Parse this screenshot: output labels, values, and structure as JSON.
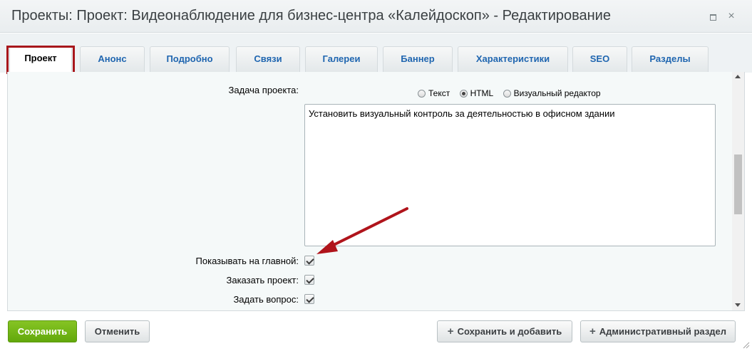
{
  "window": {
    "title": "Проекты: Проект: Видеонаблюдение для бизнес-центра «Калейдоскоп» - Редактирование",
    "maximize_icon": "maximize-icon",
    "close_icon": "close-icon",
    "close_glyph": "×"
  },
  "tabs": [
    {
      "label": "Проект",
      "active": true
    },
    {
      "label": "Анонс"
    },
    {
      "label": "Подробно"
    },
    {
      "label": "Связи"
    },
    {
      "label": "Галереи"
    },
    {
      "label": "Баннер"
    },
    {
      "label": "Характеристики"
    },
    {
      "label": "SEO"
    },
    {
      "label": "Разделы"
    }
  ],
  "form": {
    "task_label": "Задача проекта:",
    "editor_modes": [
      {
        "label": "Текст",
        "checked": false
      },
      {
        "label": "HTML",
        "checked": true
      },
      {
        "label": "Визуальный редактор",
        "checked": false
      }
    ],
    "task_value": "Установить визуальный контроль за деятельностью в офисном здании",
    "checkboxes": [
      {
        "label": "Показывать на главной:",
        "checked": true
      },
      {
        "label": "Заказать проект:",
        "checked": true
      },
      {
        "label": "Задать вопрос:",
        "checked": true
      }
    ]
  },
  "footer": {
    "save_label": "Сохранить",
    "cancel_label": "Отменить",
    "save_add_label": "Сохранить и добавить",
    "admin_label": "Административный раздел",
    "plus_glyph": "+"
  },
  "colors": {
    "highlight": "#a8171c",
    "arrow": "#b0141b",
    "save_button": "#6db112",
    "tab_text": "#2066b0"
  }
}
